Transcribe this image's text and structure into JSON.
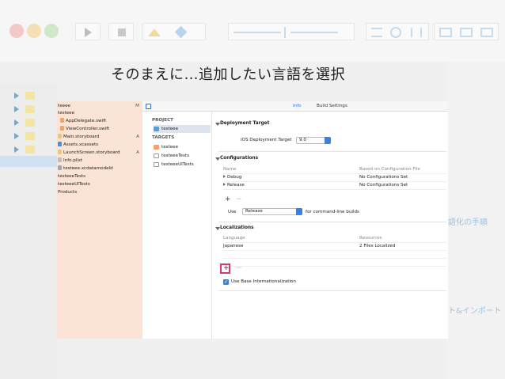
{
  "heading": "そのまえに…追加したい言語を選択",
  "side_notes": {
    "localize_steps": "語化の手順",
    "import_export": "ト&インポート"
  },
  "navigator": {
    "items": [
      {
        "label": "teeee",
        "status": "M",
        "icon": "project-icon"
      },
      {
        "label": "testeee",
        "status": "",
        "icon": "folder-icon"
      },
      {
        "label": "AppDelegate.swift",
        "status": "",
        "icon": "swift-file-icon"
      },
      {
        "label": "ViewController.swift",
        "status": "",
        "icon": "swift-file-icon"
      },
      {
        "label": "Main.storyboard",
        "status": "A",
        "icon": "storyboard-icon"
      },
      {
        "label": "Assets.xcassets",
        "status": "",
        "icon": "assets-icon"
      },
      {
        "label": "LaunchScreen.storyboard",
        "status": "A",
        "icon": "storyboard-icon"
      },
      {
        "label": "Info.plist",
        "status": "",
        "icon": "plist-icon"
      },
      {
        "label": "testeee.xcdatamodeld",
        "status": "",
        "icon": "datamodel-icon"
      },
      {
        "label": "testeeeTests",
        "status": "",
        "icon": "folder-icon"
      },
      {
        "label": "testeeeUITests",
        "status": "",
        "icon": "folder-icon"
      },
      {
        "label": "Products",
        "status": "",
        "icon": "folder-icon"
      }
    ]
  },
  "editor": {
    "tabs": [
      "Info",
      "Build Settings"
    ],
    "project_header": "PROJECT",
    "project_item": "testeee",
    "targets_header": "TARGETS",
    "targets": [
      "testeee",
      "testeeeTests",
      "testeeeUITests"
    ],
    "deployment": {
      "title": "Deployment Target",
      "label": "iOS Deployment Target",
      "value": "9.0"
    },
    "configurations": {
      "title": "Configurations",
      "col_name": "Name",
      "col_based": "Based on Configuration File",
      "rows": [
        {
          "name": "Debug",
          "based": "No Configurations Set"
        },
        {
          "name": "Release",
          "based": "No Configurations Set"
        }
      ],
      "add": "+",
      "remove": "−",
      "use_label": "Use",
      "use_value": "Release",
      "use_suffix": "for command-line builds"
    },
    "localizations": {
      "title": "Localizations",
      "col_language": "Language",
      "col_resources": "Resources",
      "rows": [
        {
          "language": "Japanese",
          "resources": "2 Files Localized"
        }
      ],
      "add": "+",
      "remove": "−",
      "base_label": "Use Base Internationalization"
    }
  },
  "colors": {
    "accent": "#3b82e0",
    "highlight": "#d23a74",
    "navigator_bg": "#fbe4d6"
  }
}
